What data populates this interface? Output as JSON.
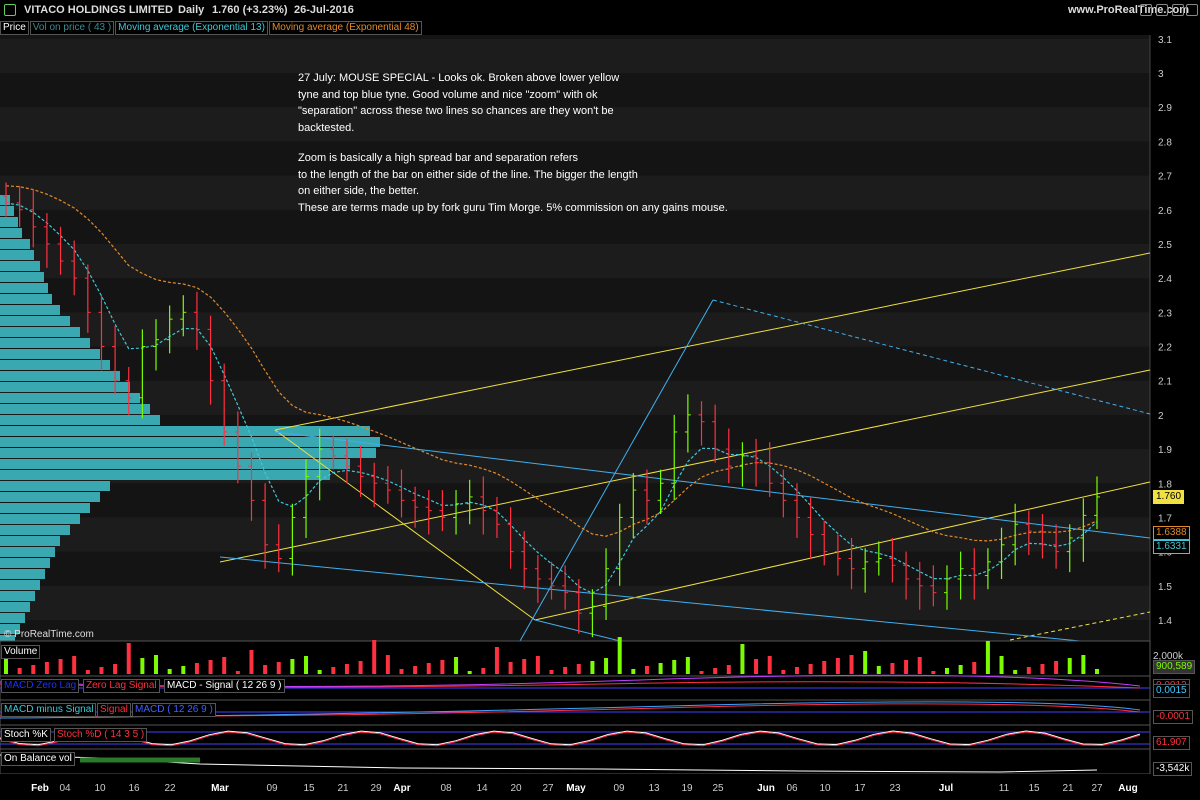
{
  "header": {
    "company": "VITACO HOLDINGS LIMITED",
    "period": "Daily",
    "quote": "1.760 (+3.23%)",
    "date": "26-Jul-2016",
    "site": "www.ProRealTime.com"
  },
  "tabs": [
    "Price",
    "Vol on price ( 43 )",
    "Moving average (Exponential 13)",
    "Moving average (Exponential 48)"
  ],
  "watermark": "© ProRealTime.com",
  "annotation": {
    "lines1": [
      "27 July: MOUSE SPECIAL - Looks ok. Broken above lower yellow",
      "tyne and top blue tyne. Good volume and nice \"zoom\" with ok",
      "\"separation\" across these two lines so chances are they won't be",
      "backtested."
    ],
    "lines2": [
      "Zoom is basically a high spread bar and separation refers",
      "to the length of the bar on either side of the line. The bigger the length",
      "on either side, the better.",
      "These are terms made up by fork guru Tim Morge. 5% commission on any gains mouse."
    ]
  },
  "price_axis": [
    "3.1",
    "3",
    "2.9",
    "2.8",
    "2.7",
    "2.6",
    "2.5",
    "2.4",
    "2.3",
    "2.2",
    "2.1",
    "2",
    "1.9",
    "1.8",
    "1.7",
    "1.6",
    "1.5",
    "1.4"
  ],
  "price_labels": {
    "last": "1.760",
    "ema48": "1.6388",
    "ema13": "1.6331"
  },
  "x_axis": [
    "Feb",
    "04",
    "10",
    "16",
    "22",
    "Mar",
    "09",
    "15",
    "21",
    "29",
    "Apr",
    "08",
    "14",
    "20",
    "27",
    "May",
    "09",
    "13",
    "19",
    "25",
    "Jun",
    "06",
    "10",
    "17",
    "23",
    "Jul",
    "11",
    "15",
    "21",
    "27",
    "Aug"
  ],
  "panels": {
    "volume": {
      "label": "Volume",
      "axis_top": "2,000k",
      "value": "900,589"
    },
    "macd1": {
      "labels": [
        "MACD Zero Lag",
        "Zero Lag Signal",
        "MACD - Signal ( 12 26 9 )"
      ],
      "value": "0.0015",
      "value2": "0.0012"
    },
    "macd2": {
      "labels": [
        "MACD minus Signal",
        "Signal",
        "MACD ( 12 26 9 )"
      ],
      "value": "-0.0001"
    },
    "stoch": {
      "labels": [
        "Stoch %K",
        "Stoch %D ( 14 3 5 )"
      ],
      "value": "61.907"
    },
    "obv": {
      "label": "On Balance vol",
      "value": "-3,542k"
    }
  },
  "colors": {
    "up": "#7CFC00",
    "down": "#ff3040",
    "ema13": "#40c8d8",
    "ema48": "#e08a2c",
    "yellow": "#f0e040",
    "blue": "#40b0f0",
    "profile": "#3aa8b0"
  },
  "chart_data": {
    "type": "candlestick",
    "title": "VITACO HOLDINGS LIMITED",
    "period": "Daily",
    "ylim": [
      1.35,
      3.15
    ],
    "x_range": [
      "2016-01-27",
      "2016-08-01"
    ],
    "series": [
      {
        "name": "Price",
        "values": [
          2.62,
          2.6,
          2.55,
          2.5,
          2.45,
          2.4,
          2.3,
          2.2,
          2.1,
          2.05,
          2.2,
          2.22,
          2.28,
          2.3,
          2.25,
          2.1,
          1.95,
          1.85,
          1.75,
          1.62,
          1.58,
          1.7,
          1.82,
          1.9,
          1.88,
          1.85,
          1.82,
          1.8,
          1.78,
          1.75,
          1.73,
          1.72,
          1.7,
          1.74,
          1.76,
          1.72,
          1.68,
          1.6,
          1.55,
          1.52,
          1.5,
          1.48,
          1.42,
          1.44,
          1.55,
          1.7,
          1.78,
          1.75,
          1.8,
          1.95,
          2.0,
          1.98,
          1.9,
          1.85,
          1.88,
          1.86,
          1.8,
          1.75,
          1.7,
          1.65,
          1.6,
          1.58,
          1.55,
          1.57,
          1.58,
          1.56,
          1.52,
          1.5,
          1.48,
          1.52,
          1.55,
          1.53,
          1.57,
          1.62,
          1.68,
          1.66,
          1.62,
          1.6,
          1.64,
          1.706,
          1.76
        ]
      },
      {
        "name": "Moving average (Exponential 13)",
        "last": 1.6331
      },
      {
        "name": "Moving average (Exponential 48)",
        "last": 1.6388
      }
    ],
    "last": 1.76,
    "change": "+3.23%"
  }
}
